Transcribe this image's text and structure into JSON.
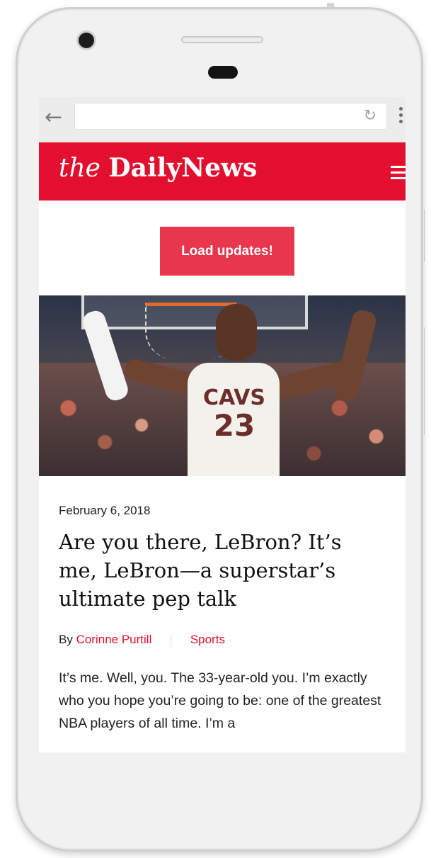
{
  "browser": {
    "back_icon": "back-arrow-icon",
    "reload_icon": "reload-icon",
    "menu_icon": "kebab-menu-icon",
    "url_value": ""
  },
  "header": {
    "logo_prefix": "the",
    "logo_name": "DailyNews",
    "menu_icon": "hamburger-icon",
    "brand_color": "#e2102e"
  },
  "actions": {
    "load_updates_label": "Load updates!"
  },
  "hero": {
    "jersey_team": "CAVS",
    "jersey_number": "23"
  },
  "article": {
    "date": "February 6, 2018",
    "headline": "Are you there, LeBron? It’s me, LeBron—a superstar’s ultimate pep talk",
    "by_label": "By",
    "author": "Corinne Purtill",
    "section": "Sports",
    "body": "It’s me. Well, you. The 33-year-old you. I’m exactly who you hope you’re going to be: one of the greatest NBA players of all time. I’m a"
  }
}
